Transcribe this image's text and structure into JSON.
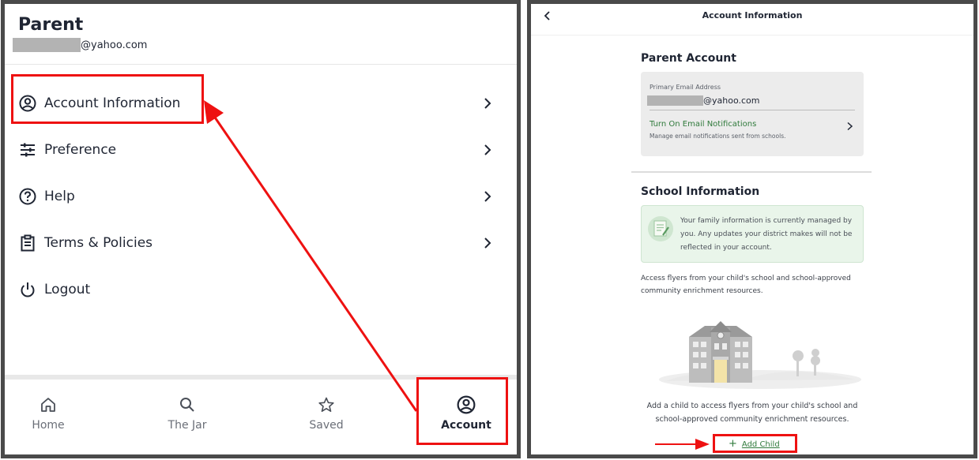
{
  "left_panel": {
    "title": "Parent",
    "email_suffix": "@yahoo.com",
    "menu": [
      {
        "label": "Account Information",
        "icon": "account-circle-icon"
      },
      {
        "label": "Preference",
        "icon": "sliders-icon"
      },
      {
        "label": "Help",
        "icon": "help-circle-icon"
      },
      {
        "label": "Terms & Policies",
        "icon": "clipboard-icon"
      },
      {
        "label": "Logout",
        "icon": "power-icon"
      }
    ],
    "bottom_nav": [
      {
        "label": "Home",
        "icon": "home-icon"
      },
      {
        "label": "The Jar",
        "icon": "search-icon"
      },
      {
        "label": "Saved",
        "icon": "star-icon"
      },
      {
        "label": "Account",
        "icon": "account-circle-icon",
        "active": true
      }
    ]
  },
  "right_panel": {
    "title": "Account Information",
    "parent_account": {
      "heading": "Parent Account",
      "primary_email_label": "Primary Email Address",
      "email_suffix": "@yahoo.com",
      "notifications_link": "Turn On Email Notifications",
      "notifications_sub": "Manage email notifications sent from schools."
    },
    "school_information": {
      "heading": "School Information",
      "notice": "Your family information is currently managed by you. Any updates your district makes will not be reflected in your account.",
      "access_text": "Access flyers from your child's school and school-approved community enrichment resources.",
      "add_child_text": "Add a child to access flyers from your child's school and school-approved community enrichment resources.",
      "add_child_label": "Add Child"
    }
  },
  "colors": {
    "highlight": "#ee1111",
    "link_green": "#2f7a3b",
    "text_dark": "#1f2533",
    "panel_border": "#4a4a4a"
  }
}
